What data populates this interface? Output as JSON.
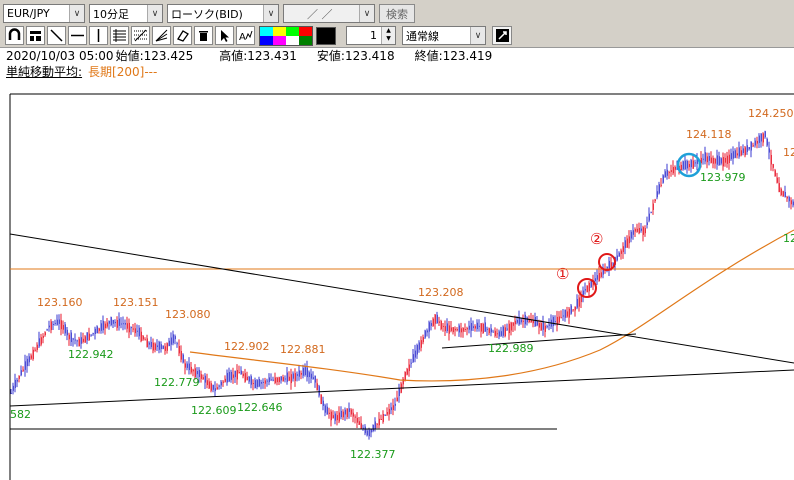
{
  "toolbar": {
    "symbol": "EUR/JPY",
    "timeframe": "10分足",
    "chart_type": "ローソク(BID)",
    "date_field": "／ ／",
    "search_label": "検索",
    "line_width": "1",
    "line_style": "通常線"
  },
  "info": {
    "datetime": "2020/10/03 05:00",
    "open": "始値:123.425",
    "high": "高値:123.431",
    "low": "安値:123.418",
    "close": "終値:123.419"
  },
  "indicator": {
    "name": "単純移動平均:",
    "long": "長期[200]---"
  },
  "colors": {
    "candle_up": "#e8192c",
    "candle_down": "#3a3ad0",
    "ma": "#e07818",
    "high_label": "#d2691e",
    "low_label": "#1a9a1a",
    "circle_red": "#e01818",
    "circle_blue": "#1ea0d8",
    "palette": [
      "#00ffff",
      "#ffff00",
      "#00ff00",
      "#ff00ff",
      "#ff0000",
      "#0000ff",
      "#ffffff",
      "#008000"
    ]
  },
  "chart": {
    "annotations": [
      {
        "text": "123.160",
        "type": "high"
      },
      {
        "text": "123.151",
        "type": "high"
      },
      {
        "text": "123.080",
        "type": "high"
      },
      {
        "text": "122.902",
        "type": "high"
      },
      {
        "text": "122.881",
        "type": "high"
      },
      {
        "text": "123.208",
        "type": "high"
      },
      {
        "text": "124.118",
        "type": "high"
      },
      {
        "text": "124.250",
        "type": "high"
      },
      {
        "text": "122.942",
        "type": "low"
      },
      {
        "text": "122.779",
        "type": "low"
      },
      {
        "text": "122.609",
        "type": "low"
      },
      {
        "text": "122.646",
        "type": "low"
      },
      {
        "text": "122.377",
        "type": "low"
      },
      {
        "text": "122.989",
        "type": "low"
      },
      {
        "text": "123.979",
        "type": "low"
      },
      {
        "text": "582",
        "type": "low"
      },
      {
        "text": "12",
        "type": "high"
      },
      {
        "text": "12",
        "type": "low"
      }
    ],
    "markers": [
      "①",
      "②"
    ]
  }
}
